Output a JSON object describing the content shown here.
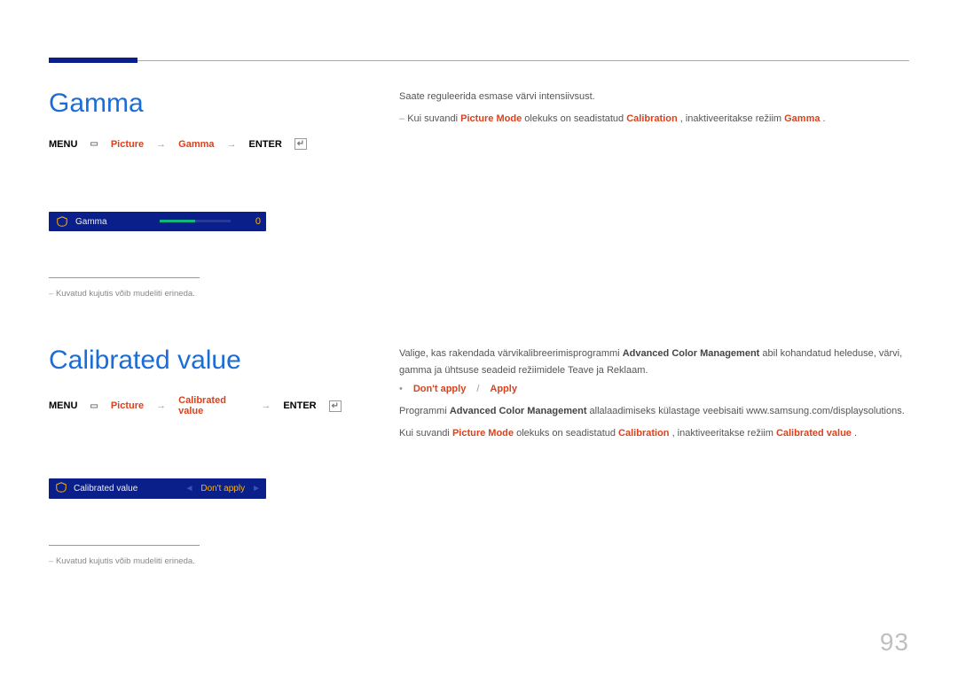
{
  "page_number": "93",
  "section1": {
    "title": "Gamma",
    "breadcrumb": {
      "menu": "MENU",
      "picture": "Picture",
      "item": "Gamma",
      "enter": "ENTER"
    },
    "ui": {
      "label": "Gamma",
      "value": "0"
    },
    "footnote": "Kuvatud kujutis võib mudeliti erineda.",
    "right": {
      "desc1": "Saate reguleerida esmase värvi intensiivsust.",
      "note_pre": "Kui suvandi ",
      "note_b1": "Picture Mode",
      "note_mid": " olekuks on seadistatud ",
      "note_b2": "Calibration",
      "note_mid2": ", inaktiveeritakse režiim ",
      "note_b3": "Gamma",
      "note_end": "."
    }
  },
  "section2": {
    "title": "Calibrated value",
    "breadcrumb": {
      "menu": "MENU",
      "picture": "Picture",
      "item": "Calibrated value",
      "enter": "ENTER"
    },
    "ui": {
      "label": "Calibrated value",
      "value": "Don't apply"
    },
    "footnote": "Kuvatud kujutis võib mudeliti erineda.",
    "right": {
      "desc1_pre": "Valige, kas rakendada värvikalibreerimisprogrammi ",
      "desc1_b": "Advanced Color Management",
      "desc1_post": " abil kohandatud heleduse, värvi, gamma ja ühtsuse seadeid režiimidele Teave ja Reklaam.",
      "options": {
        "opt1": "Don't apply",
        "opt2": "Apply"
      },
      "note1_pre": "Programmi ",
      "note1_b": "Advanced Color Management",
      "note1_post": " allalaadimiseks külastage veebisaiti www.samsung.com/displaysolutions.",
      "note2_pre": "Kui suvandi ",
      "note2_b1": "Picture Mode",
      "note2_mid": " olekuks on seadistatud ",
      "note2_b2": "Calibration",
      "note2_mid2": ", inaktiveeritakse režiim ",
      "note2_b3": "Calibrated value",
      "note2_end": "."
    }
  }
}
